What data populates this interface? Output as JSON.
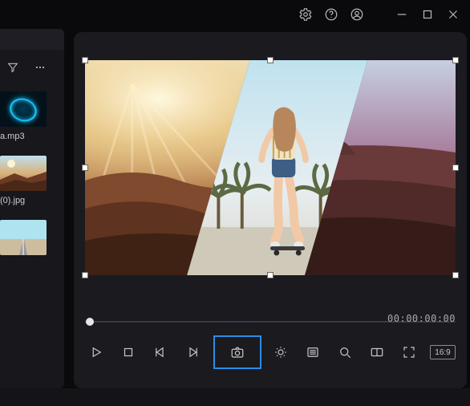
{
  "titlebar": {
    "icons": [
      "settings",
      "help",
      "account",
      "minimize",
      "maximize",
      "close"
    ]
  },
  "sidebar": {
    "items": [
      {
        "filename": "a.mp3"
      },
      {
        "filename": "(0).jpg"
      },
      {
        "filename": ""
      }
    ]
  },
  "preview": {
    "timecode": "00:00:00:00",
    "aspect_label": "16:9"
  },
  "controls": {
    "play": "play",
    "stop": "stop",
    "prev_frame": "prev-frame",
    "next_frame": "next-frame",
    "snapshot": "snapshot",
    "color": "color",
    "list": "list",
    "search_zoom": "zoom",
    "compare": "compare",
    "fullscreen": "fullscreen"
  }
}
